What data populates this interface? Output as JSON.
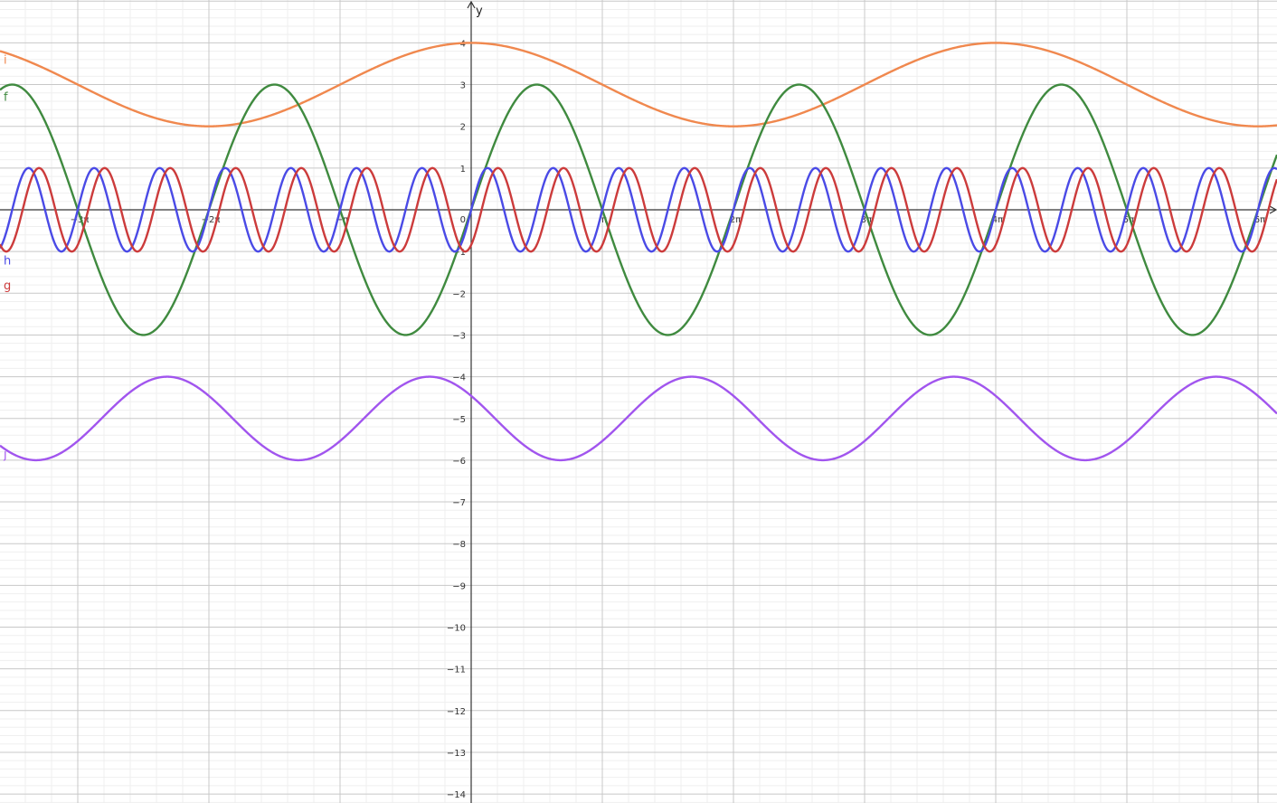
{
  "chart_data": {
    "type": "line",
    "title": "",
    "xlabel": "",
    "ylabel": "y",
    "x_domain": [
      -3.57,
      6.13
    ],
    "x_units": "multiples of π",
    "ylim": [
      -14.2,
      5.05
    ],
    "grid": true,
    "x_ticks": [
      {
        "value": -3,
        "label": "−3π"
      },
      {
        "value": -2,
        "label": "−2π"
      },
      {
        "value": -1,
        "label": "−π"
      },
      {
        "value": 1,
        "label": "π"
      },
      {
        "value": 2,
        "label": "2π"
      },
      {
        "value": 3,
        "label": "3π"
      },
      {
        "value": 4,
        "label": "4π"
      },
      {
        "value": 5,
        "label": "5π"
      },
      {
        "value": 6,
        "label": "6π"
      }
    ],
    "origin_label": "0",
    "y_ticks": [
      {
        "value": 4,
        "label": "4"
      },
      {
        "value": 3,
        "label": "3"
      },
      {
        "value": 2,
        "label": "2"
      },
      {
        "value": 1,
        "label": "1"
      },
      {
        "value": -1,
        "label": "−1"
      },
      {
        "value": -2,
        "label": "−2"
      },
      {
        "value": -3,
        "label": "−3"
      },
      {
        "value": -4,
        "label": "−4"
      },
      {
        "value": -5,
        "label": "−5"
      },
      {
        "value": -6,
        "label": "−6"
      },
      {
        "value": -7,
        "label": "−7"
      },
      {
        "value": -8,
        "label": "−8"
      },
      {
        "value": -9,
        "label": "−9"
      },
      {
        "value": -10,
        "label": "−10"
      },
      {
        "value": -11,
        "label": "−11"
      },
      {
        "value": -12,
        "label": "−12"
      },
      {
        "value": -13,
        "label": "−13"
      },
      {
        "value": -14,
        "label": "−14"
      }
    ],
    "series": [
      {
        "name": "i",
        "color": "#f0884e",
        "formula": "3 + cos(x/2)",
        "amplitude": 1,
        "angular_frequency": 0.5,
        "phase": 0,
        "vertical_shift": 3,
        "wave": "cos"
      },
      {
        "name": "f",
        "color": "#3f8a3f",
        "formula": "3 sin(x)",
        "amplitude": 3,
        "angular_frequency": 1,
        "phase": 0,
        "vertical_shift": 0,
        "wave": "sin"
      },
      {
        "name": "h",
        "color": "#4a4ae6",
        "formula": "sin(4x)",
        "amplitude": 1,
        "angular_frequency": 4,
        "phase": 0,
        "vertical_shift": 0,
        "wave": "sin"
      },
      {
        "name": "g",
        "color": "#cc3b3b",
        "formula": "sin(4x − 1)",
        "amplitude": 1,
        "angular_frequency": 4,
        "phase": -1,
        "vertical_shift": 0,
        "wave": "sin"
      },
      {
        "name": "j",
        "color": "#a155ee",
        "formula": "−5 + cos(x + 1)",
        "amplitude": 1,
        "angular_frequency": 1,
        "phase": 1,
        "vertical_shift": -5,
        "wave": "cos"
      }
    ]
  }
}
